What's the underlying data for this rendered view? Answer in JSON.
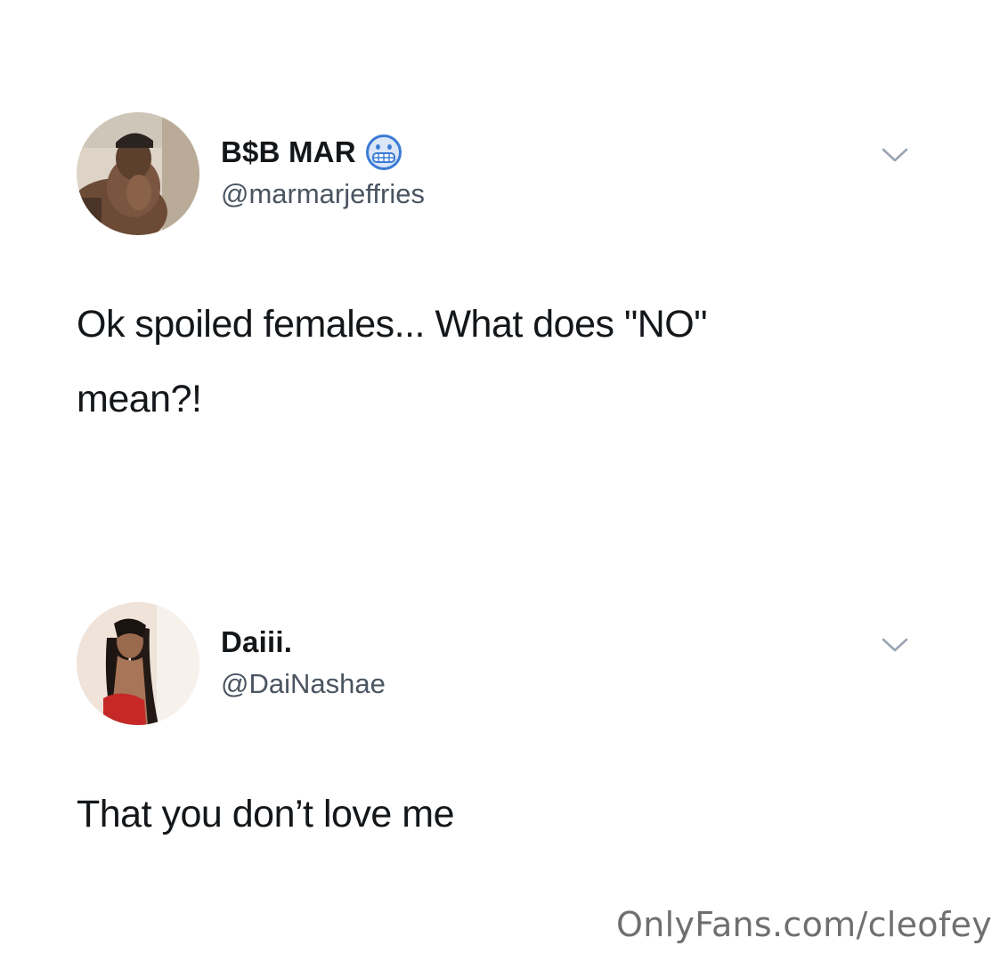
{
  "tweets": [
    {
      "display_name": "B$B MAR",
      "handle": "@marmarjeffries",
      "name_emoji": "grimacing-face-emoji",
      "text_lines": [
        "Ok spoiled females... What does \"NO\"",
        "mean?!"
      ],
      "menu_icon": "chevron-down-icon"
    },
    {
      "display_name": "Daiii.",
      "handle": "@DaiNashae",
      "text_lines": [
        "That you don’t love me"
      ],
      "menu_icon": "chevron-down-icon"
    }
  ],
  "watermark": "OnlyFans.com/cleofey",
  "colors": {
    "background": "#ffffff",
    "text": "#14171a",
    "handle": "#4a5561",
    "chevron": "#9aa5b1",
    "watermark": "#6f6f6f"
  }
}
